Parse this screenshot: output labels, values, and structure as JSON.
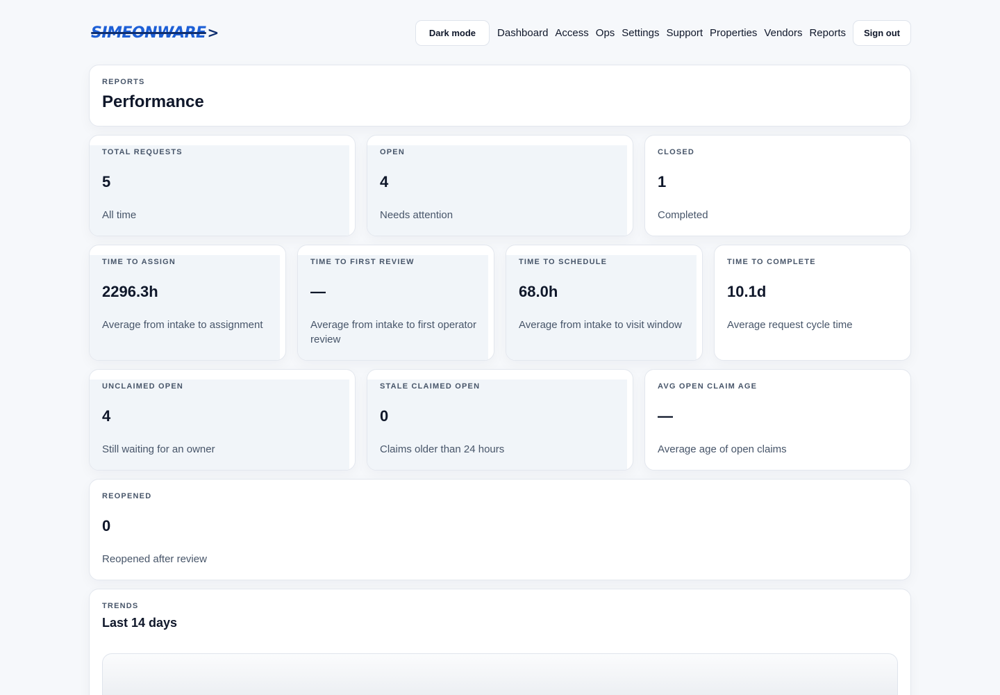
{
  "brand": {
    "name": "SIMEONWARE",
    "arrow": ">"
  },
  "nav": {
    "dark_mode_label": "Dark mode",
    "links": [
      "Dashboard",
      "Access",
      "Ops",
      "Settings",
      "Support",
      "Properties",
      "Vendors",
      "Reports"
    ],
    "sign_out_label": "Sign out"
  },
  "page_header": {
    "eyebrow": "REPORTS",
    "title": "Performance"
  },
  "metrics": {
    "total_requests": {
      "label": "TOTAL REQUESTS",
      "value": "5",
      "sub": "All time"
    },
    "open": {
      "label": "OPEN",
      "value": "4",
      "sub": "Needs attention"
    },
    "closed": {
      "label": "CLOSED",
      "value": "1",
      "sub": "Completed"
    },
    "time_to_assign": {
      "label": "TIME TO ASSIGN",
      "value": "2296.3h",
      "sub": "Average from intake to assignment"
    },
    "time_to_first_review": {
      "label": "TIME TO FIRST REVIEW",
      "value": "—",
      "sub": "Average from intake to first operator review"
    },
    "time_to_schedule": {
      "label": "TIME TO SCHEDULE",
      "value": "68.0h",
      "sub": "Average from intake to visit window"
    },
    "time_to_complete": {
      "label": "TIME TO COMPLETE",
      "value": "10.1d",
      "sub": "Average request cycle time"
    },
    "unclaimed_open": {
      "label": "UNCLAIMED OPEN",
      "value": "4",
      "sub": "Still waiting for an owner"
    },
    "stale_claimed_open": {
      "label": "STALE CLAIMED OPEN",
      "value": "0",
      "sub": "Claims older than 24 hours"
    },
    "avg_open_claim_age": {
      "label": "AVG OPEN CLAIM AGE",
      "value": "—",
      "sub": "Average age of open claims"
    },
    "reopened": {
      "label": "REOPENED",
      "value": "0",
      "sub": "Reopened after review"
    }
  },
  "trends": {
    "eyebrow": "TRENDS",
    "title": "Last 14 days"
  },
  "colors": {
    "background": "#f6f8fb",
    "brand_blue": "#1d5fd6",
    "brand_navy": "#0f2f70",
    "card_tint": "#f1f5f9"
  }
}
